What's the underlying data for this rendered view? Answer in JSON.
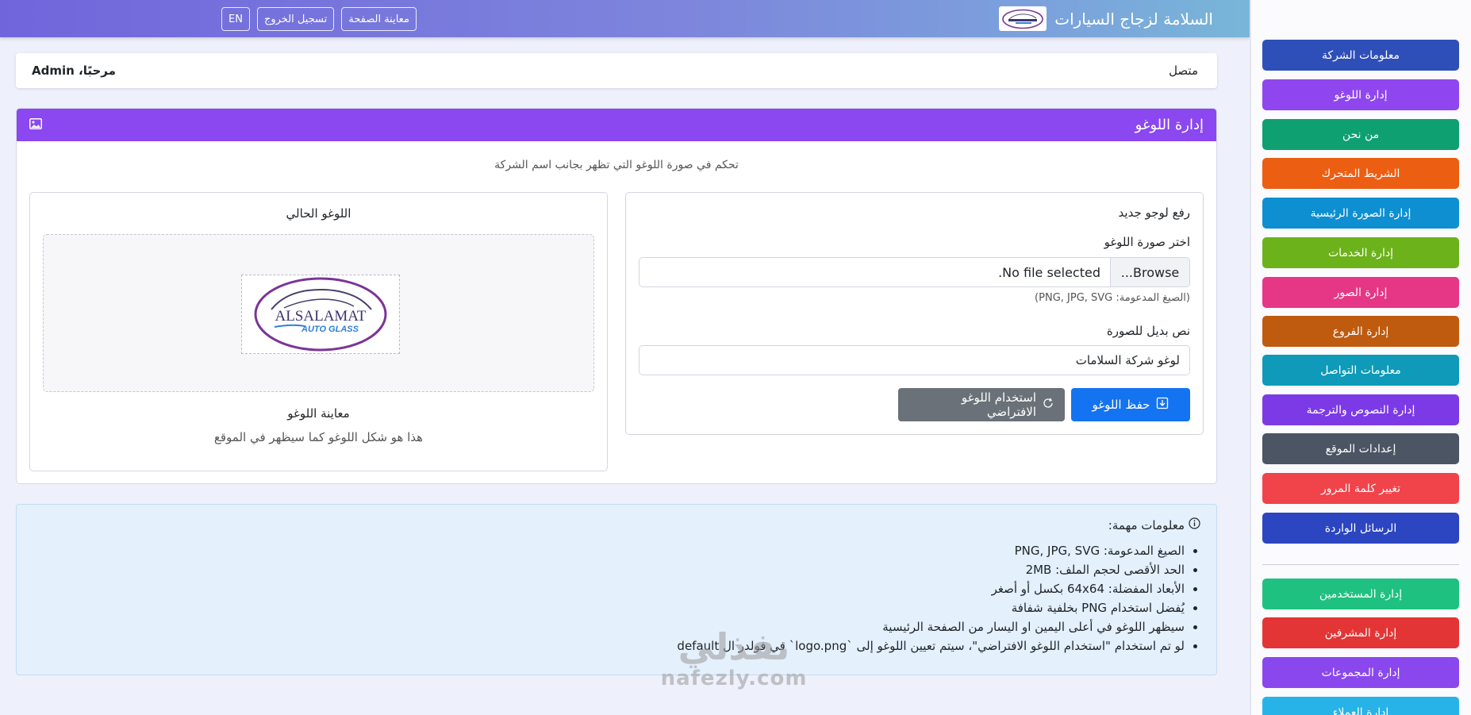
{
  "topbar": {
    "brand_title": "السلامة لزجاج السيارات",
    "preview_label": "معاينة الصفحة",
    "logout_label": "تسجيل الخروج",
    "lang_label": "EN"
  },
  "sidebar": {
    "items": [
      {
        "label": "معلومات الشركة",
        "color": "#2f4fb8"
      },
      {
        "label": "إدارة اللوغو",
        "color": "#8f46ee"
      },
      {
        "label": "من نحن",
        "color": "#0fa071"
      },
      {
        "label": "الشريط المتحرك",
        "color": "#ec5e12"
      },
      {
        "label": "إدارة الصورة الرئيسية",
        "color": "#0e8fd2"
      },
      {
        "label": "إدارة الخدمات",
        "color": "#6cb21a"
      },
      {
        "label": "إدارة الصور",
        "color": "#e53785"
      },
      {
        "label": "إدارة الفروع",
        "color": "#bf5b0f"
      },
      {
        "label": "معلومات التواصل",
        "color": "#0e9ab8"
      },
      {
        "label": "إدارة النصوص والترجمة",
        "color": "#7c3ae7"
      },
      {
        "label": "إعدادات الموقع",
        "color": "#4b5563"
      },
      {
        "label": "تغيير كلمة المرور",
        "color": "#f1434a"
      },
      {
        "label": "الرسائل الواردة",
        "color": "#2c45c0"
      },
      {
        "label": "إدارة المستخدمين",
        "color": "#1fc180"
      },
      {
        "label": "إدارة المشرفين",
        "color": "#e33535"
      },
      {
        "label": "إدارة المجموعات",
        "color": "#8a47ee"
      },
      {
        "label": "إدارة العملاء",
        "color": "#27b3e8"
      }
    ]
  },
  "welcome": {
    "status": "متصل",
    "greeting": "مرحبًا، Admin"
  },
  "logo_card": {
    "title": "إدارة اللوغو",
    "subtitle": "تحكم في صورة اللوغو التي تظهر بجانب اسم الشركة",
    "upload": {
      "heading": "رفع لوجو جديد",
      "choose_label": "اختر صورة اللوغو",
      "browse_label": "Browse...",
      "file_status": "No file selected.",
      "formats_hint": "(الصيغ المدعومة: PNG, JPG, SVG)",
      "alt_label": "نص بديل للصورة",
      "alt_value": "لوغو شركة السلامات",
      "save_label": "حفظ اللوغو",
      "default_label": "استخدام اللوغو الافتراضي"
    },
    "current": {
      "heading": "اللوغو الحالي",
      "logo_text_main": "ALSALAMAT",
      "logo_text_sub": "AUTO GLASS",
      "preview_title": "معاينة اللوغو",
      "preview_desc": "هذا هو شكل اللوغو كما سيظهر في الموقع"
    }
  },
  "info": {
    "title": "معلومات مهمة:",
    "items": [
      "الصيغ المدعومة: PNG, JPG, SVG",
      "الحد الأقصى لحجم الملف: 2MB",
      "الأبعاد المفضلة: 64x64 بكسل أو أصغر",
      "يُفضل استخدام PNG بخلفية شفافة",
      "سيظهر اللوغو في أعلى اليمين او اليسار من الصفحة الرئيسية",
      "لو تم استخدام \"استخدام اللوغو الافتراضي\"، سيتم تعيين اللوغو إلى `logo.png` في فولدر ال default"
    ]
  },
  "watermark": {
    "arabic": "نفذلي",
    "latin": "nafezly.com"
  }
}
